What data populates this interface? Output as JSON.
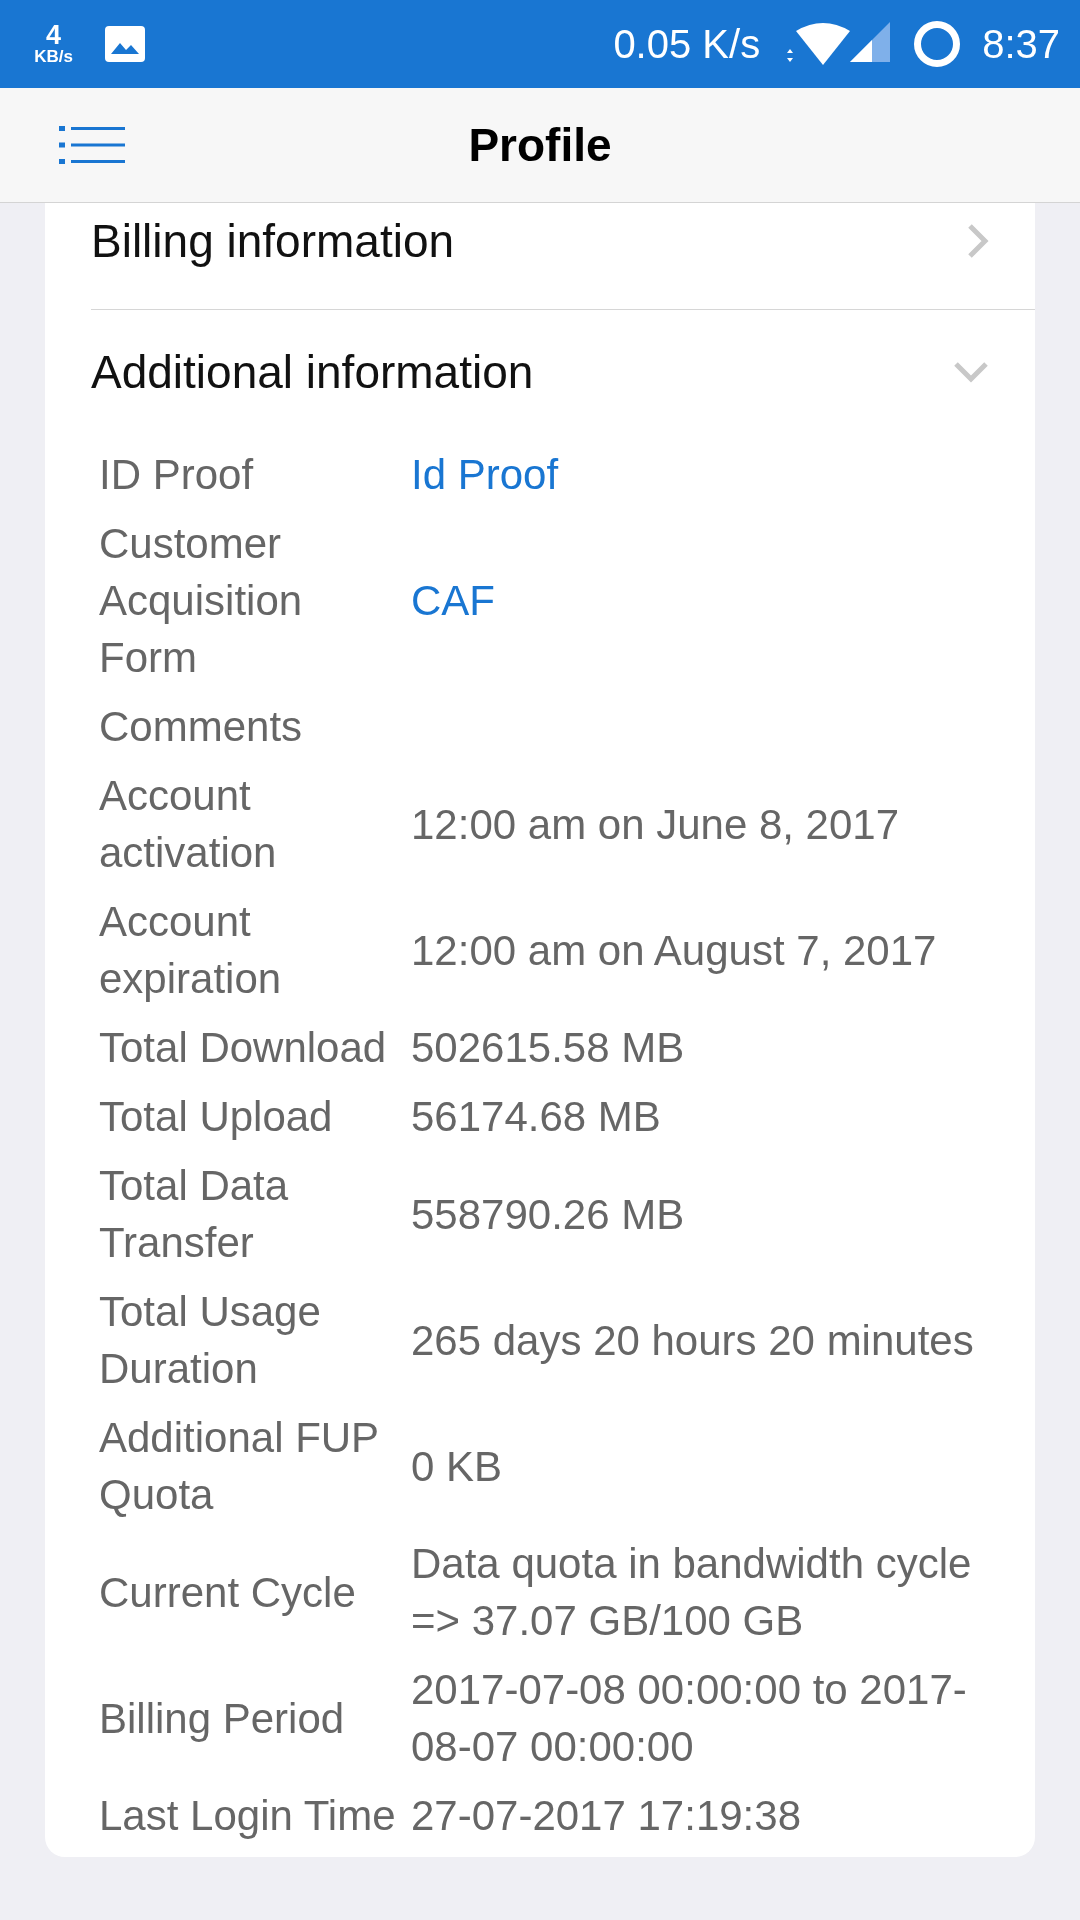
{
  "status_bar": {
    "speed_value": "4",
    "speed_unit": "KB/s",
    "network_speed": "0.05 K/s",
    "time": "8:37"
  },
  "header": {
    "title": "Profile"
  },
  "sections": [
    {
      "title": "Billing information",
      "expanded": false
    },
    {
      "title": "Additional information",
      "expanded": true,
      "rows": [
        {
          "label": "ID Proof",
          "value": "Id Proof",
          "kind": "link"
        },
        {
          "label": "Customer Acquisition Form",
          "value": "CAF",
          "kind": "link"
        },
        {
          "label": "Comments",
          "kind": "text"
        },
        {
          "label": "Account activation",
          "value": "12:00 am on June 8, 2017",
          "kind": "text"
        },
        {
          "label": "Account expiration",
          "value": "12:00 am on August 7, 2017",
          "kind": "text"
        },
        {
          "label": "Total Download",
          "value": "502615.58 MB",
          "kind": "text"
        },
        {
          "label": "Total Upload",
          "value": "56174.68 MB",
          "kind": "text"
        },
        {
          "label": "Total Data Transfer",
          "value": "558790.26 MB",
          "kind": "text"
        },
        {
          "label": "Total Usage Duration",
          "value": "265 days 20 hours 20 minutes",
          "kind": "text"
        },
        {
          "label": "Additional FUP Quota",
          "value": "0 KB",
          "kind": "text"
        },
        {
          "label": "Current Cycle",
          "value": "Data quota in bandwidth cycle => 37.07 GB/100 GB",
          "kind": "text"
        },
        {
          "label": "Billing Period",
          "value": "2017-07-08 00:00:00 to 2017-08-07 00:00:00",
          "kind": "text"
        },
        {
          "label": "Last Login Time",
          "value": "27-07-2017 17:19:38",
          "kind": "text"
        }
      ]
    }
  ]
}
